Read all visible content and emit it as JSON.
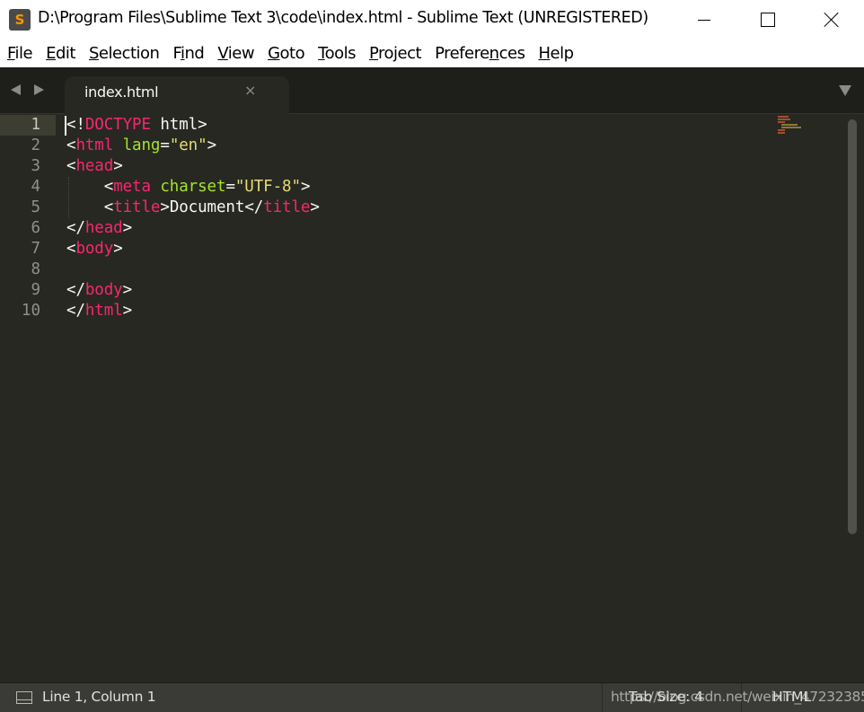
{
  "window": {
    "title": "D:\\Program Files\\Sublime Text 3\\code\\index.html - Sublime Text (UNREGISTERED)",
    "app_icon_letter": "S"
  },
  "menu": [
    {
      "label": "File",
      "u": "F",
      "rest": "ile"
    },
    {
      "label": "Edit",
      "u": "E",
      "rest": "dit"
    },
    {
      "label": "Selection",
      "u": "S",
      "rest": "election"
    },
    {
      "label": "Find",
      "pre": "F",
      "u": "i",
      "rest": "nd"
    },
    {
      "label": "View",
      "u": "V",
      "rest": "iew"
    },
    {
      "label": "Goto",
      "u": "G",
      "rest": "oto"
    },
    {
      "label": "Tools",
      "u": "T",
      "rest": "ools"
    },
    {
      "label": "Project",
      "u": "P",
      "rest": "roject"
    },
    {
      "label": "Preferences",
      "pre": "Prefere",
      "u": "n",
      "rest": "ces"
    },
    {
      "label": "Help",
      "u": "H",
      "rest": "elp"
    }
  ],
  "tab": {
    "label": "index.html",
    "close_glyph": "×"
  },
  "editor": {
    "line_numbers": [
      "1",
      "2",
      "3",
      "4",
      "5",
      "6",
      "7",
      "8",
      "9",
      "10"
    ],
    "lines": [
      "<!DOCTYPE html>",
      "<html lang=\"en\">",
      "<head>",
      "    <meta charset=\"UTF-8\">",
      "    <title>Document</title>",
      "</head>",
      "<body>",
      "",
      "</body>",
      "</html>"
    ]
  },
  "status": {
    "position": "Line 1, Column 1",
    "tab_size": "Tab Size: 4",
    "syntax": "HTML",
    "watermark": "https://blog.csdn.net/weixin_47232385"
  },
  "colors": {
    "background": "#272822",
    "tag": "#f92672",
    "attribute": "#a6e22e",
    "string": "#e6db74",
    "text": "#f8f8f2"
  }
}
